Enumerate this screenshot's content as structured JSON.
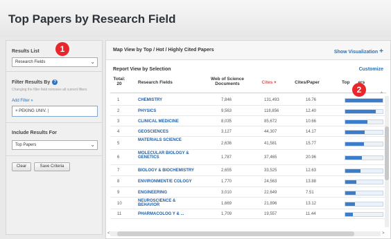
{
  "page": {
    "title": "Top Papers by Research Field"
  },
  "sidebar": {
    "results_list_label": "Results List",
    "results_list_value": "Research Fields",
    "filter_label": "Filter Results By",
    "filter_note": "Changing the filter field removes all current filters",
    "add_filter": "Add Filter »",
    "filter_value": "× PEKING UNIV.",
    "include_label": "Include Results For",
    "include_value": "Top Papers",
    "clear_label": "Clear",
    "save_label": "Save Criteria",
    "badge1": "1"
  },
  "main": {
    "map_title": "Map View by Top / Hot / Highly Cited Papers",
    "show_vis": "Show Visualization",
    "show_vis_icon": "+",
    "report_label": "Report View by Selection",
    "customize": "Customize",
    "badge2": "2",
    "headers": {
      "total": "Total:",
      "total_count": "20",
      "field": "Research Fields",
      "wos1": "Web of Science",
      "wos2": "Documents",
      "cites": "Cites",
      "cites_sort": "▾",
      "cites_per": "Cites/Paper",
      "top_papers_a": "Top",
      "top_papers_b": "ers"
    },
    "rows": [
      {
        "n": "1",
        "field": "CHEMISTRY",
        "docs": "7,846",
        "cites": "131,493",
        "cpp": "16.76",
        "frac": 1.0
      },
      {
        "n": "2",
        "field": "PHYSICS",
        "docs": "9,563",
        "cites": "118,856",
        "cpp": "12.40",
        "frac": 0.82
      },
      {
        "n": "3",
        "field": "CLINICAL MEDICINE",
        "docs": "8,035",
        "cites": "85,672",
        "cpp": "10.66",
        "frac": 0.6
      },
      {
        "n": "4",
        "field": "GEOSCIENCES",
        "docs": "3,127",
        "cites": "44,307",
        "cpp": "14.17",
        "frac": 0.52
      },
      {
        "n": "5",
        "field": "MATERIALS SCIENCE",
        "docs": "2,636",
        "cites": "41,581",
        "cpp": "15.77",
        "frac": 0.5
      },
      {
        "n": "6",
        "field": "MOLECULAR BIOLOGY & GENETICS",
        "docs": "1,787",
        "cites": "37,465",
        "cpp": "20.96",
        "frac": 0.45
      },
      {
        "n": "7",
        "field": "BIOLOGY & BIOCHEMISTRY",
        "docs": "2,655",
        "cites": "33,525",
        "cpp": "12.63",
        "frac": 0.4
      },
      {
        "n": "8",
        "field": "ENVIRONMENT/E COLOGY",
        "docs": "1,770",
        "cites": "24,563",
        "cpp": "13.88",
        "frac": 0.3
      },
      {
        "n": "9",
        "field": "ENGINEERING",
        "docs": "3,010",
        "cites": "22,649",
        "cpp": "7.51",
        "frac": 0.28
      },
      {
        "n": "10",
        "field": "NEUROSCIENCE & BEHAVIOR",
        "docs": "1,669",
        "cites": "21,896",
        "cpp": "13.12",
        "frac": 0.25
      },
      {
        "n": "11",
        "field": "PHARMACOLOG Y & ...",
        "docs": "1,709",
        "cites": "19,557",
        "cpp": "11.44",
        "frac": 0.2
      }
    ]
  },
  "icons": {
    "chevron": "chevron-down-icon",
    "help": "help-icon"
  },
  "colors": {
    "accent": "#2b6fb6",
    "badge": "#e8262c",
    "bar": "#3d7cc9"
  }
}
